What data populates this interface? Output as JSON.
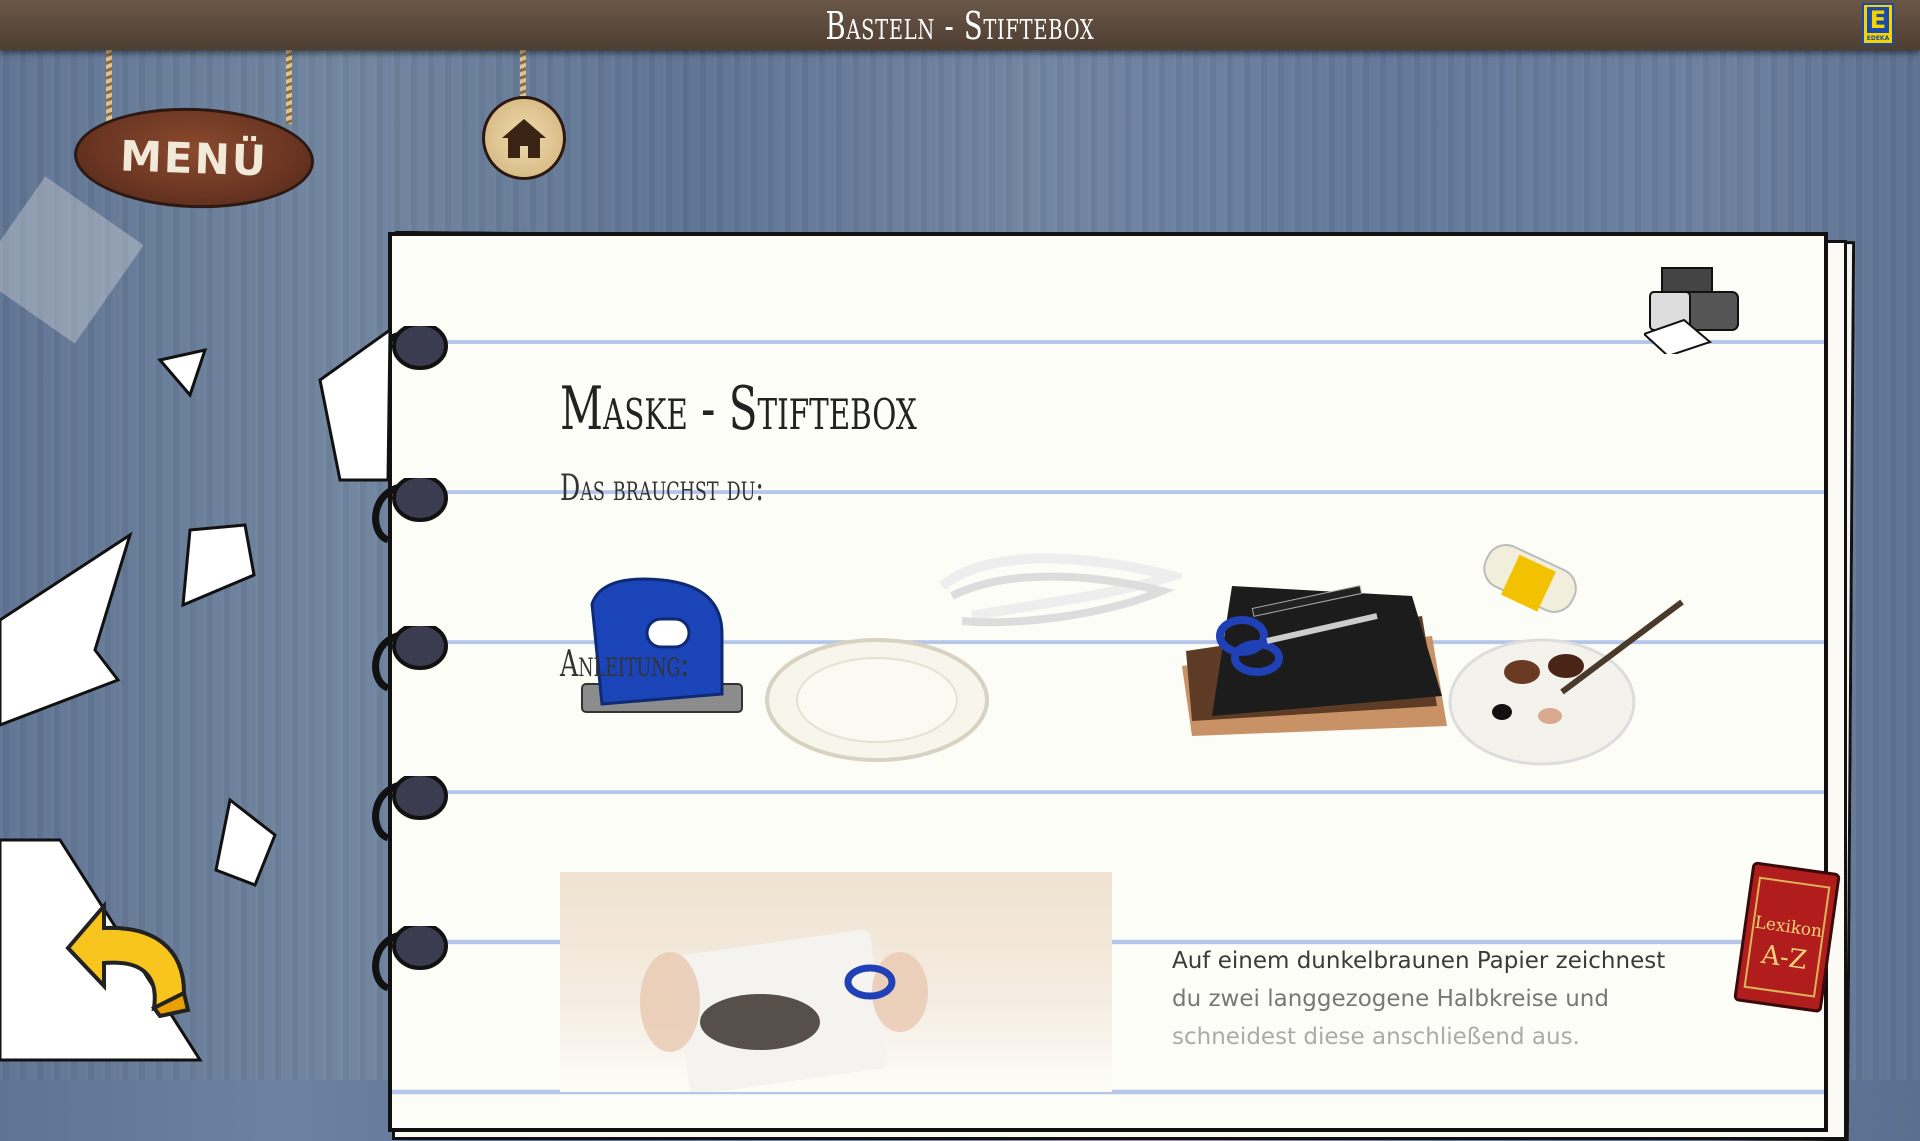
{
  "topbar": {
    "title": "Basteln - Stiftebox",
    "logo_text": "EDEKA",
    "logo_letter": "E"
  },
  "nav": {
    "menu_label": "MENÜ",
    "home_icon": "house-icon",
    "back_icon": "back-arrow-icon"
  },
  "content": {
    "title": "Maske - Stiftebox",
    "needs_heading": "Das brauchst du:",
    "instructions_heading": "Anleitung:",
    "materials": [
      "hole-punch-icon",
      "paper-plate-icon",
      "elastic-band-icon",
      "colored-paper-icon",
      "scissors-icon",
      "marker-icon",
      "glue-stick-icon",
      "paint-palette-icon"
    ],
    "step1": {
      "line1": "Auf einem dunkelbraunen Papier zeichnest",
      "line2": "du zwei langgezogene Halbkreise und",
      "line3": "schneidest diese anschließend aus."
    }
  },
  "tools": {
    "print_icon": "printer-icon",
    "lexikon_line1": "Lexikon",
    "lexikon_line2": "A-Z"
  },
  "colors": {
    "accent_wood": "#6a3522",
    "paper_lines": "#b6c5ea",
    "edeka_yellow": "#f5d400",
    "edeka_blue": "#1c4aa8"
  }
}
